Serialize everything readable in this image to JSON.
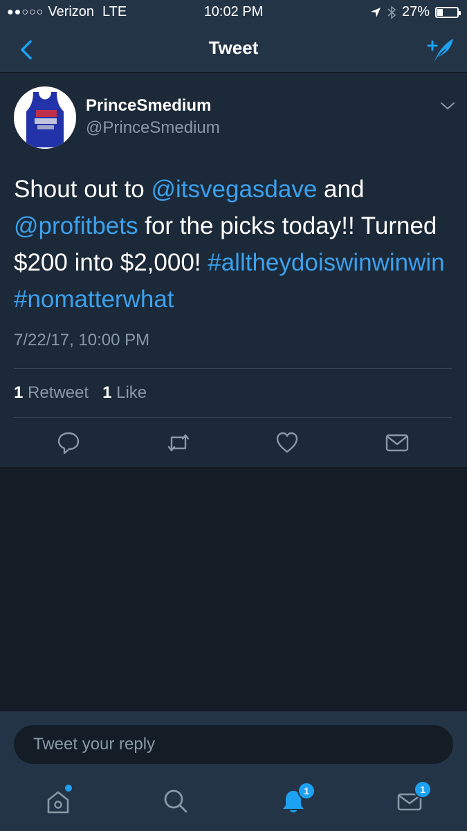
{
  "status_bar": {
    "carrier": "Verizon",
    "network": "LTE",
    "time": "10:02 PM",
    "battery_percent": "27%",
    "battery_level": 0.27
  },
  "nav": {
    "title": "Tweet"
  },
  "tweet": {
    "display_name": "PrinceSmedium",
    "handle": "@PrinceSmedium",
    "text_1": "Shout out to ",
    "mention_1": "@itsvegasdave",
    "text_2": " and ",
    "mention_2": "@profitbets",
    "text_3": " for the picks today!! Turned $200 into $2,000! ",
    "hashtag_1": "#alltheydoiswinwinwin",
    "text_4": " ",
    "hashtag_2": "#nomatterwhat",
    "timestamp": "7/22/17, 10:00 PM",
    "retweet_count": "1",
    "retweet_label": "Retweet",
    "like_count": "1",
    "like_label": "Like"
  },
  "reply": {
    "placeholder": "Tweet your reply"
  },
  "tabbar": {
    "notifications_badge": "1",
    "messages_badge": "1"
  },
  "colors": {
    "accent": "#1da1f2",
    "background": "#141d26",
    "card": "#1c2938",
    "bar": "#243447"
  }
}
